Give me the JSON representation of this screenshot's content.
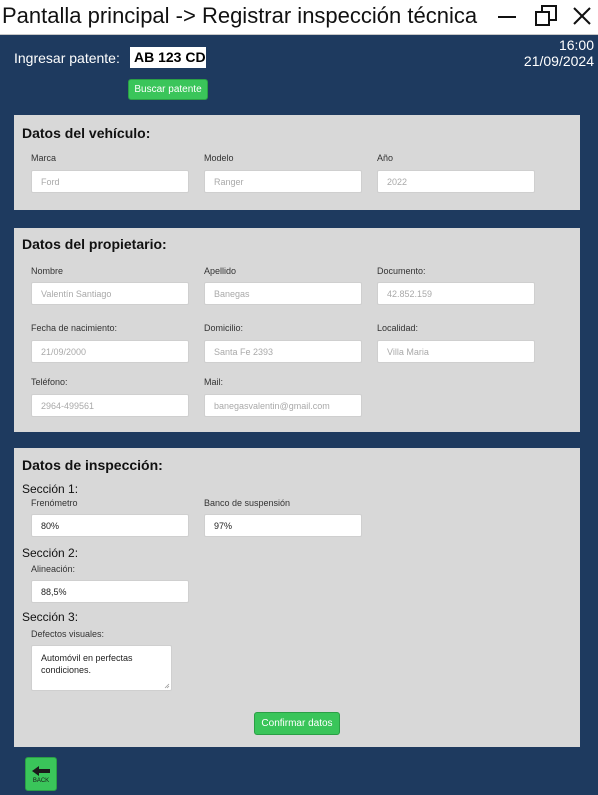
{
  "window": {
    "title": "Pantalla principal -> Registrar inspección técnica",
    "controls": [
      "minimize-icon",
      "restore-icon",
      "close-icon"
    ]
  },
  "header": {
    "plate_label": "Ingresar patente:",
    "plate_value": "AB 123 CD",
    "search_button": "Buscar patente",
    "time": "16:00",
    "date": "21/09/2024"
  },
  "vehicle": {
    "title": "Datos del vehículo:",
    "fields": [
      {
        "label": "Marca",
        "placeholder": "Ford"
      },
      {
        "label": "Modelo",
        "placeholder": "Ranger"
      },
      {
        "label": "Año",
        "placeholder": "2022"
      }
    ]
  },
  "owner": {
    "title": "Datos del propietario:",
    "fields": [
      {
        "label": "Nombre",
        "placeholder": "Valentín Santiago"
      },
      {
        "label": "Apellido",
        "placeholder": "Banegas"
      },
      {
        "label": "Documento:",
        "placeholder": "42.852.159"
      },
      {
        "label": "Fecha de nacimiento:",
        "placeholder": "21/09/2000"
      },
      {
        "label": "Domicilio:",
        "placeholder": "Santa Fe 2393"
      },
      {
        "label": "Localidad:",
        "placeholder": "Villa Maria"
      },
      {
        "label": "Teléfono:",
        "placeholder": "2964-499561"
      },
      {
        "label": "Mail:",
        "placeholder": "banegasvalentin@gmail.com"
      }
    ]
  },
  "inspection": {
    "title": "Datos de inspección:",
    "section1": "Sección 1:",
    "brake_label": "Frenómetro",
    "brake_value": "80%",
    "suspension_label": "Banco de suspensión",
    "suspension_value": "97%",
    "section2": "Sección 2:",
    "alignment_label": "Alineación:",
    "alignment_value": "88,5%",
    "section3": "Sección 3:",
    "defects_label": "Defectos visuales:",
    "defects_value": "Automóvil en perfectas condiciones.",
    "confirm_button": "Confirmar datos"
  },
  "footer": {
    "back_label": "BACK",
    "back_icon": "back-arrow-icon"
  },
  "colors": {
    "background": "#1e3a5f",
    "panel": "#d8d8d8",
    "accent": "#3ac55a"
  }
}
